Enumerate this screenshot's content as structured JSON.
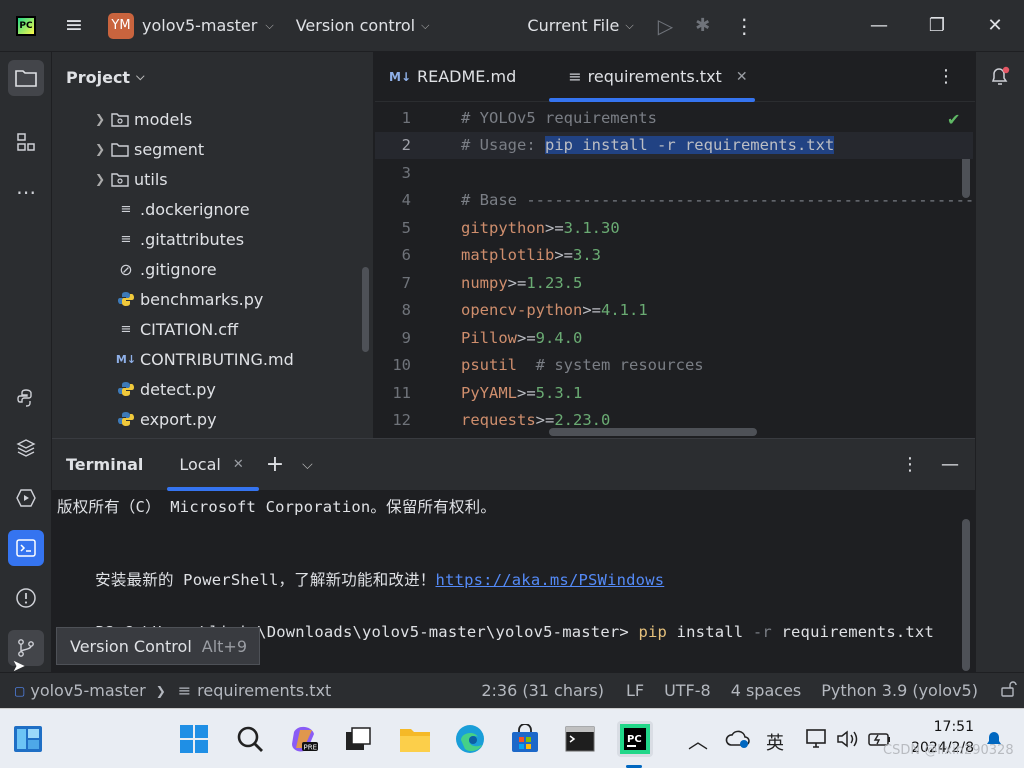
{
  "titlebar": {
    "project_badge": "YM",
    "project_name": "yolov5-master",
    "vcs_label": "Version control",
    "run_config": "Current File"
  },
  "project_panel": {
    "title": "Project",
    "items": [
      {
        "label": "models",
        "type": "folder"
      },
      {
        "label": "segment",
        "type": "folder"
      },
      {
        "label": "utils",
        "type": "folder"
      },
      {
        "label": ".dockerignore",
        "type": "text"
      },
      {
        "label": ".gitattributes",
        "type": "text"
      },
      {
        "label": ".gitignore",
        "type": "ignore"
      },
      {
        "label": "benchmarks.py",
        "type": "python"
      },
      {
        "label": "CITATION.cff",
        "type": "text"
      },
      {
        "label": "CONTRIBUTING.md",
        "type": "markdown"
      },
      {
        "label": "detect.py",
        "type": "python"
      },
      {
        "label": "export.py",
        "type": "python"
      }
    ]
  },
  "editor": {
    "tabs": [
      {
        "label": "README.md",
        "icon": "M↓"
      },
      {
        "label": "requirements.txt",
        "icon": "≡"
      }
    ],
    "lines": [
      {
        "n": "1",
        "text": "# YOLOv5 requirements"
      },
      {
        "n": "2",
        "pre": "# Usage: ",
        "sel": "pip install -r requirements.txt"
      },
      {
        "n": "3",
        "text": ""
      },
      {
        "n": "4",
        "text": "# Base ------------------------------------------------"
      },
      {
        "n": "5",
        "pkg": "gitpython",
        "op": ">=",
        "ver": "3.1.30"
      },
      {
        "n": "6",
        "pkg": "matplotlib",
        "op": ">=",
        "ver": "3.3"
      },
      {
        "n": "7",
        "pkg": "numpy",
        "op": ">=",
        "ver": "1.23.5"
      },
      {
        "n": "8",
        "pkg": "opencv-python",
        "op": ">=",
        "ver": "4.1.1"
      },
      {
        "n": "9",
        "pkg": "Pillow",
        "op": ">=",
        "ver": "9.4.0"
      },
      {
        "n": "10",
        "pkg": "psutil",
        "op": "  ",
        "comment": "# system resources"
      },
      {
        "n": "11",
        "pkg": "PyYAML",
        "op": ">=",
        "ver": "5.3.1"
      },
      {
        "n": "12",
        "pkg": "requests",
        "op": ">=",
        "ver": "2.23.0"
      }
    ]
  },
  "terminal": {
    "title": "Terminal",
    "tab": "Local",
    "line1": "版权所有（C） Microsoft Corporation。保留所有权利。",
    "line2_pre": "安装最新的 PowerShell，了解新功能和改进！",
    "line2_link": "https://aka.ms/PSWindows",
    "prompt": "PS C:\\Users\\lixin\\Downloads\\yolov5-master\\yolov5-master> ",
    "cmd_pip": "pip",
    "cmd_install": " install ",
    "cmd_flag": "-r",
    "cmd_file": " requirements.txt"
  },
  "tooltip": {
    "label": "Version Control",
    "shortcut": "Alt+9"
  },
  "statusbar": {
    "project": "yolov5-master",
    "file": "requirements.txt",
    "position": "2:36 (31 chars)",
    "line_sep": "LF",
    "encoding": "UTF-8",
    "indent": "4 spaces",
    "interpreter": "Python 3.9 (yolov5)"
  },
  "taskbar": {
    "ime": "英",
    "time": "17:51",
    "date": "2024/2/8",
    "watermark": "CSDN @lixin290328"
  },
  "colors": {
    "accent": "#3574f0",
    "selection": "#214283",
    "keyword": "#cf8e6d",
    "number": "#6aab73"
  }
}
